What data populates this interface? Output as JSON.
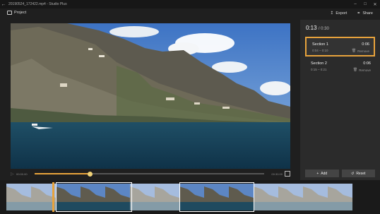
{
  "window": {
    "title": "20190524_172422.mp4 - Studio Plus",
    "back_glyph": "←",
    "minimize_glyph": "–",
    "maximize_glyph": "□",
    "close_glyph": "✕"
  },
  "toolbar": {
    "project_label": "Project",
    "export_label": "Export",
    "export_icon": "export-icon",
    "share_label": "Share",
    "share_icon": "share-icon"
  },
  "playback": {
    "play_glyph": "▷",
    "current_time": "00:00.00",
    "end_time": "00:30.00",
    "progress_fraction": 0.24
  },
  "panel": {
    "current": "0:13",
    "total": "/ 0:30",
    "sections": [
      {
        "name": "Section 1",
        "duration": "0:06",
        "range": "0:04 – 0:10",
        "remove_label": "Remove",
        "selected": true
      },
      {
        "name": "Section 2",
        "duration": "0:06",
        "range": "0:15 – 0:21",
        "remove_label": "Remove",
        "selected": false
      }
    ],
    "add_label": "Add",
    "reset_label": "Reset"
  },
  "colors": {
    "accent": "#e8a33c",
    "background": "#1f1f1f",
    "panel": "#2b2b2b"
  }
}
